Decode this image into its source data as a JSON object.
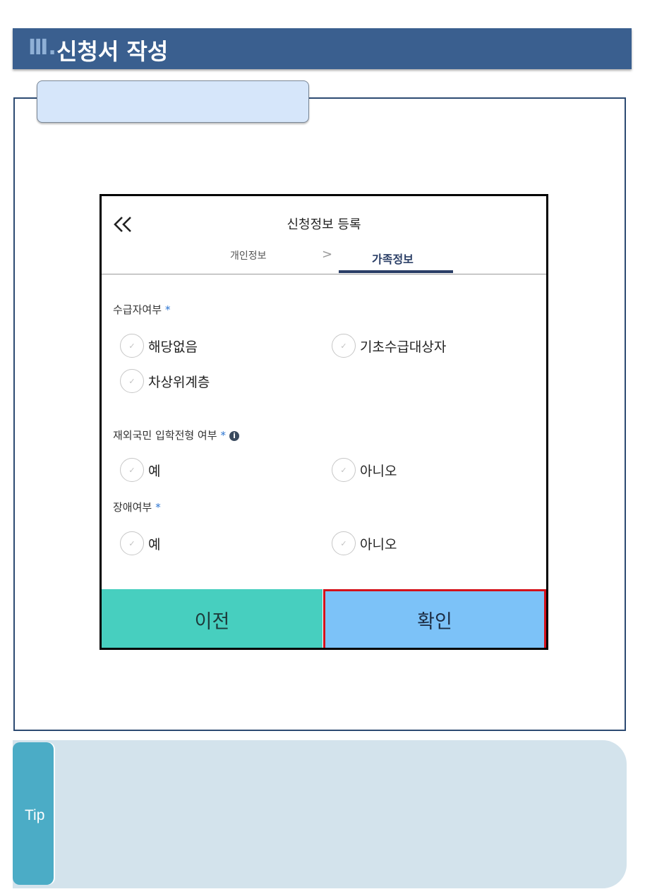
{
  "header": {
    "number": "Ⅲ.",
    "title": "신청서 작성"
  },
  "colors": {
    "header_bg": "#3a5f8f",
    "prev_button": "#47cfbf",
    "ok_button": "#7cc2f8",
    "highlight_border": "#d4111a",
    "tip_bg": "#d3e3ec",
    "tip_label_bg": "#4bacc6"
  },
  "screen": {
    "title": "신청정보 등록",
    "back_icon": "double-chevron-left-icon",
    "tabs": {
      "personal": "개인정보",
      "separator": ">",
      "family": "가족정보"
    },
    "sections": {
      "recipient": {
        "label": "수급자여부",
        "required": "*",
        "options": [
          "해당없음",
          "기초수급대상자",
          "차상위계층"
        ]
      },
      "overseas": {
        "label": "재외국민 입학전형 여부",
        "required": "*",
        "info_icon": "i",
        "options": [
          "예",
          "아니오"
        ]
      },
      "disability": {
        "label": "장애여부",
        "required": "*",
        "options": [
          "예",
          "아니오"
        ]
      }
    },
    "buttons": {
      "prev": "이전",
      "ok": "확인"
    }
  },
  "tip": {
    "label": "Tip"
  }
}
